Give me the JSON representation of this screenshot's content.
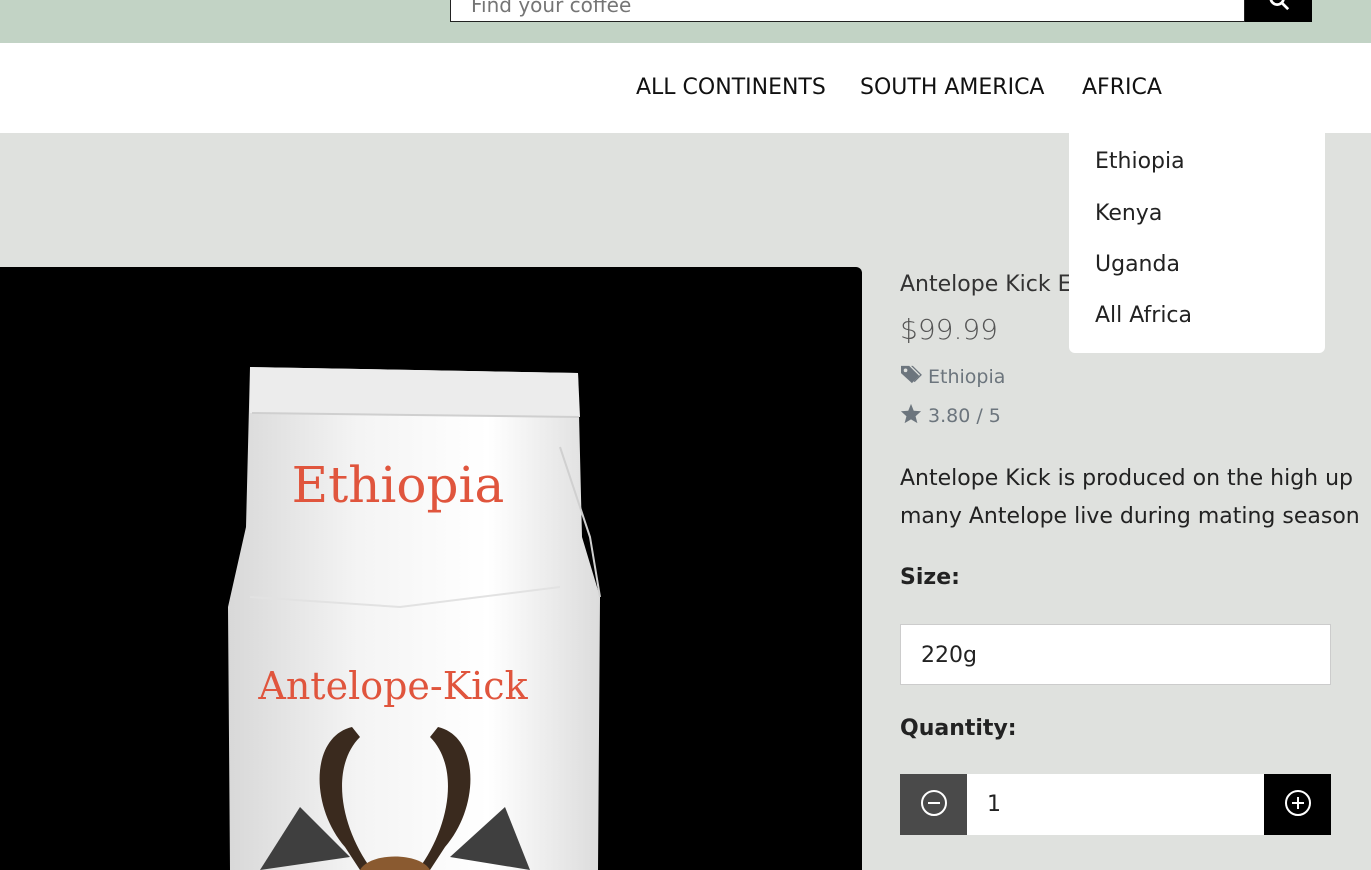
{
  "search": {
    "placeholder": "Find your coffee"
  },
  "nav": {
    "links": [
      "ALL CONTINENTS",
      "SOUTH AMERICA",
      "AFRICA"
    ]
  },
  "dropdown": {
    "items": [
      "Ethiopia",
      "Kenya",
      "Uganda",
      "All Africa"
    ]
  },
  "product": {
    "title": "Antelope Kick E",
    "price": "$99.99",
    "category": "Ethiopia",
    "rating": "3.80 / 5",
    "description_line1": "Antelope Kick is produced on the high up",
    "description_line2": "many Antelope live during mating season",
    "bag_text_origin": "Ethiopia",
    "bag_text_name": "Antelope-Kick"
  },
  "form": {
    "size_label": "Size:",
    "size_value": "220g",
    "quantity_label": "Quantity:",
    "quantity_value": "1"
  },
  "icons": {
    "search": "search-icon",
    "tag": "tag-icon",
    "star": "star-icon",
    "minus": "minus-circle-icon",
    "plus": "plus-circle-icon"
  },
  "colors": {
    "topbar": "#c2d3c5",
    "page_bg": "#dfe1de",
    "bag_text": "#e0553d"
  }
}
